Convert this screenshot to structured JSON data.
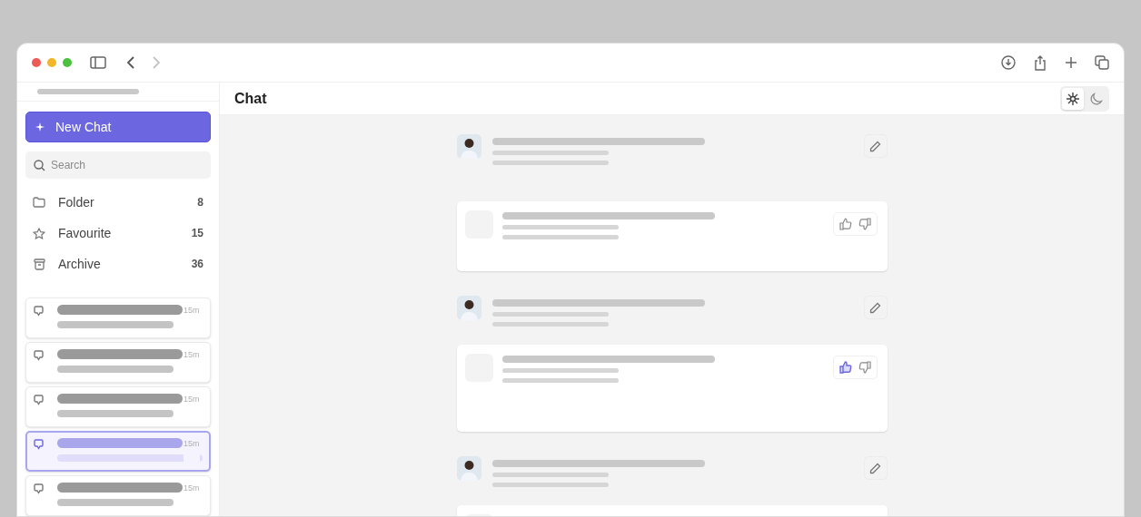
{
  "browser": {
    "forward_disabled": true
  },
  "sidebar": {
    "new_chat": "New Chat",
    "search": {
      "placeholder": "Search"
    },
    "nav": [
      {
        "kind": "folder",
        "label": "Folder",
        "count": "8"
      },
      {
        "kind": "star",
        "label": "Favourite",
        "count": "15"
      },
      {
        "kind": "archive",
        "label": "Archive",
        "count": "36"
      }
    ],
    "chats": [
      {
        "time": "15m",
        "selected": false
      },
      {
        "time": "15m",
        "selected": false
      },
      {
        "time": "15m",
        "selected": false
      },
      {
        "time": "15m",
        "selected": true
      },
      {
        "time": "15m",
        "selected": false
      }
    ]
  },
  "header": {
    "title": "Chat",
    "theme": [
      {
        "kind": "light",
        "selected": true
      },
      {
        "kind": "dark",
        "selected": false
      }
    ]
  },
  "messages": [
    {
      "kind": "user"
    },
    {
      "kind": "response",
      "liked": false
    },
    {
      "kind": "user"
    },
    {
      "kind": "response",
      "liked": true
    },
    {
      "kind": "user"
    },
    {
      "kind": "response"
    }
  ]
}
